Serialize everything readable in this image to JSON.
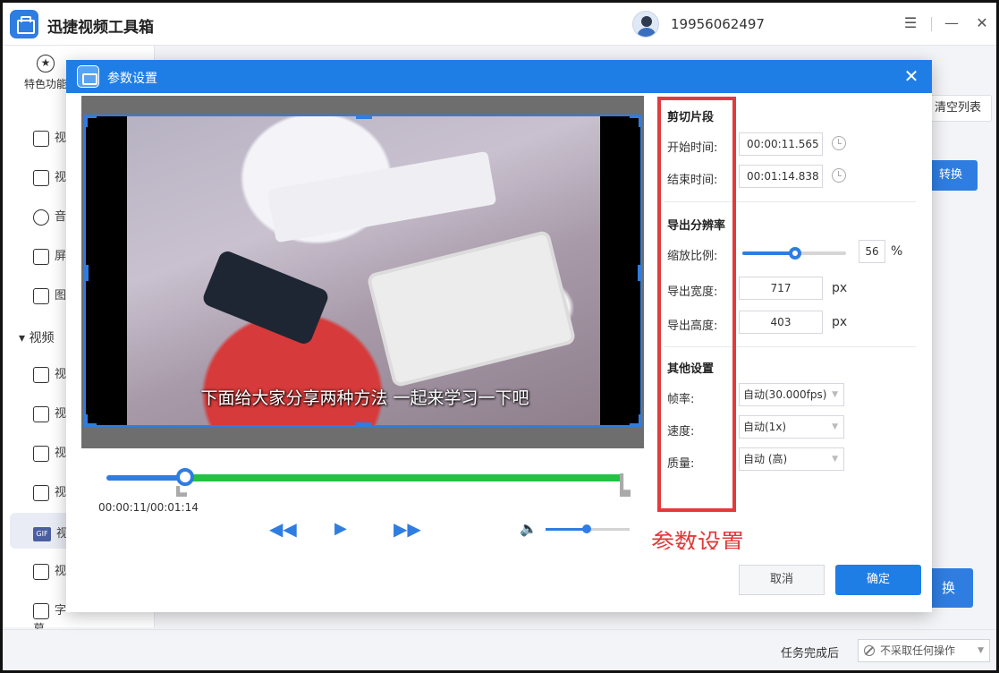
{
  "app": {
    "title": "迅捷视频工具箱",
    "phone": "19956062497",
    "menu_icon": "☰",
    "min_icon": "—",
    "close_icon": "✕"
  },
  "sidebar": {
    "feature_label": "特色功能",
    "feature_icon": "★",
    "section_video": "视频",
    "items": [
      "视",
      "视",
      "音",
      "屏",
      "图",
      "视",
      "视",
      "视",
      "视",
      "视",
      "视",
      "字幕"
    ]
  },
  "background": {
    "clear_label": "清空列表",
    "convert_label": "转换",
    "convert_all_label": "换",
    "task_label": "任务完成后",
    "task_value": "不采取任何操作"
  },
  "modal": {
    "title": "参数设置",
    "close_icon": "✕",
    "subtitle": "下面给大家分享两种方法 一起来学习一下吧",
    "timecode": "00:00:11/00:01:14",
    "rewind_icon": "◀◀",
    "play_icon": "▶",
    "forward_icon": "▶▶",
    "volume_icon": "🔈",
    "trim_progress_fraction": 0.15,
    "volume_fraction": 0.5
  },
  "settings": {
    "clip_title": "剪切片段",
    "start_label": "开始时间:",
    "start_value": "00:00:11.565",
    "end_label": "结束时间:",
    "end_value": "00:01:14.838",
    "resolution_title": "导出分辨率",
    "scale_label": "缩放比例:",
    "scale_value": "56",
    "scale_unit": "%",
    "width_label": "导出宽度:",
    "width_value": "717",
    "height_label": "导出高度:",
    "height_value": "403",
    "px_unit": "px",
    "other_title": "其他设置",
    "fps_label": "帧率:",
    "fps_value": "自动(30.000fps)",
    "speed_label": "速度:",
    "speed_value": "自动(1x)",
    "quality_label": "质量:",
    "quality_value": "自动 (高)"
  },
  "annotation": "参数设置",
  "footer": {
    "cancel_label": "取消",
    "ok_label": "确定"
  }
}
